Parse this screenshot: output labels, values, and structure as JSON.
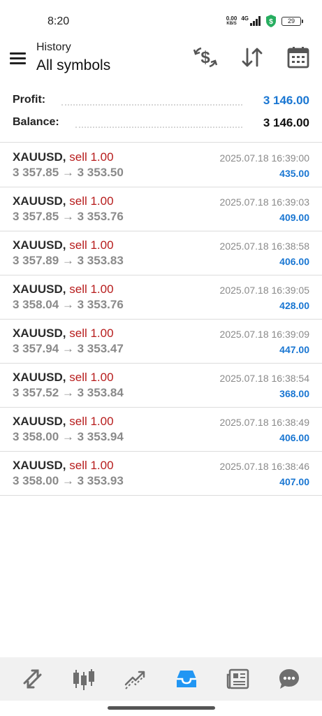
{
  "status_bar": {
    "time": "8:20",
    "net_speed_value": "0.00",
    "net_speed_unit": "KB/S",
    "network_type": "4G",
    "battery_level": "29"
  },
  "header": {
    "subtitle": "History",
    "title": "All symbols",
    "icons": [
      "currency-exchange-icon",
      "sort-icon",
      "calendar-icon"
    ]
  },
  "summary": {
    "profit_label": "Profit:",
    "profit_value": "3 146.00",
    "balance_label": "Balance:",
    "balance_value": "3 146.00"
  },
  "trades": [
    {
      "symbol": "XAUUSD,",
      "side": "sell 1.00",
      "prices": "3 357.85 → 3 353.50",
      "time": "2025.07.18 16:39:00",
      "profit": "435.00"
    },
    {
      "symbol": "XAUUSD,",
      "side": "sell 1.00",
      "prices": "3 357.85 → 3 353.76",
      "time": "2025.07.18 16:39:03",
      "profit": "409.00"
    },
    {
      "symbol": "XAUUSD,",
      "side": "sell 1.00",
      "prices": "3 357.89 → 3 353.83",
      "time": "2025.07.18 16:38:58",
      "profit": "406.00"
    },
    {
      "symbol": "XAUUSD,",
      "side": "sell 1.00",
      "prices": "3 358.04 → 3 353.76",
      "time": "2025.07.18 16:39:05",
      "profit": "428.00"
    },
    {
      "symbol": "XAUUSD,",
      "side": "sell 1.00",
      "prices": "3 357.94 → 3 353.47",
      "time": "2025.07.18 16:39:09",
      "profit": "447.00"
    },
    {
      "symbol": "XAUUSD,",
      "side": "sell 1.00",
      "prices": "3 357.52 → 3 353.84",
      "time": "2025.07.18 16:38:54",
      "profit": "368.00"
    },
    {
      "symbol": "XAUUSD,",
      "side": "sell 1.00",
      "prices": "3 358.00 → 3 353.94",
      "time": "2025.07.18 16:38:49",
      "profit": "406.00"
    },
    {
      "symbol": "XAUUSD,",
      "side": "sell 1.00",
      "prices": "3 358.00 → 3 353.93",
      "time": "2025.07.18 16:38:46",
      "profit": "407.00"
    }
  ],
  "bottom_nav": {
    "items": [
      "quotes-icon",
      "chart-icon",
      "trade-icon",
      "history-icon",
      "news-icon",
      "chat-icon"
    ],
    "active": "history-icon"
  },
  "colors": {
    "accent": "#1976d2",
    "sell": "#b71c1c",
    "muted": "#8a8a8a",
    "nav_inactive": "#6e6e6e",
    "nav_active": "#2196f3"
  }
}
